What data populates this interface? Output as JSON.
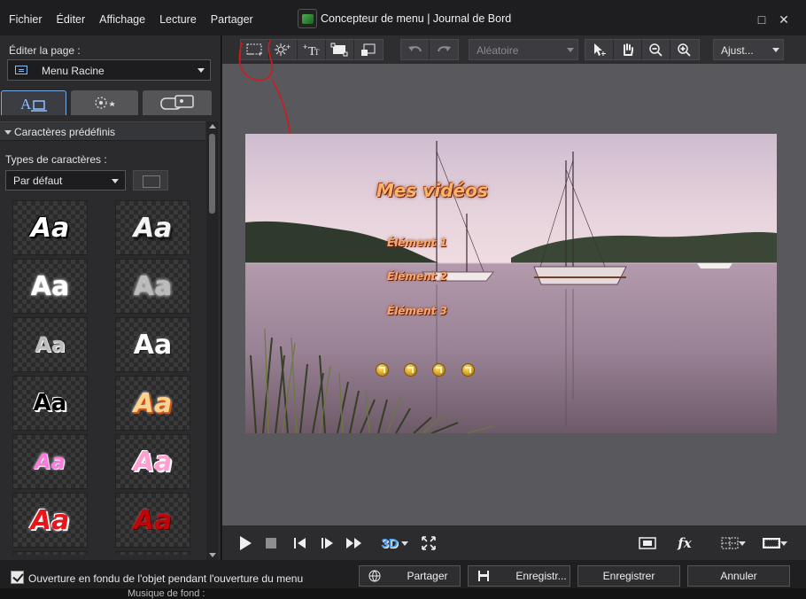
{
  "menubar": [
    "Fichier",
    "Éditer",
    "Affichage",
    "Lecture",
    "Partager"
  ],
  "window": {
    "title": "Concepteur de menu | Journal de Bord",
    "maximize": "□",
    "close": "✕"
  },
  "left": {
    "page_label": "Éditer la page :",
    "page_value": "Menu Racine",
    "section_title": "Caractères prédéfinis",
    "types_label": "Types de caractères :",
    "types_value": "Par défaut",
    "tiles": [
      "Aa",
      "Aa",
      "Aa",
      "Aa",
      "Aa",
      "Aa",
      "Aa",
      "Aa",
      "Aa",
      "Aa",
      "Aa",
      "Aa"
    ]
  },
  "toolbar": {
    "mode_value": "Aléatoire",
    "fit_value": "Ajust..."
  },
  "preview": {
    "title": "Mes vidéos",
    "items": [
      "Élément 1",
      "Élément 2",
      "Élément 3"
    ]
  },
  "playbar": {
    "stereo": "3D",
    "fx": "fx"
  },
  "bottom": {
    "checkbox_label": "Ouverture en fondu de l'objet pendant l'ouverture du menu",
    "share": "Partager",
    "save_as": "Enregistr...",
    "save": "Enregistrer",
    "cancel": "Annuler",
    "strip_text": "Musique de fond :"
  }
}
